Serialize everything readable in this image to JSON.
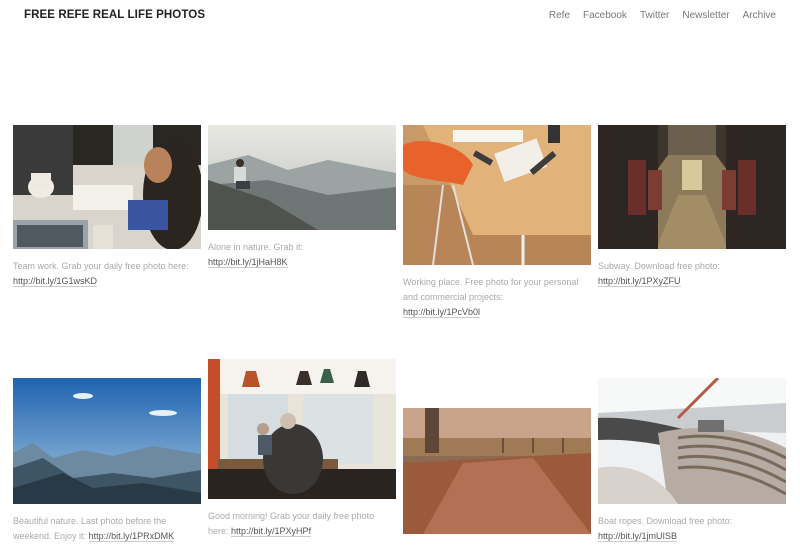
{
  "site": {
    "title": "FREE REFE REAL LIFE PHOTOS"
  },
  "nav": [
    {
      "label": "Refe"
    },
    {
      "label": "Facebook"
    },
    {
      "label": "Twitter"
    },
    {
      "label": "Newsletter"
    },
    {
      "label": "Archive"
    }
  ],
  "posts": [
    {
      "caption": "Team work. Grab your daily free photo here:",
      "link": "http://bit.ly/1G1wsKD"
    },
    {
      "caption": "Alone in nature. Grab it:",
      "link": "http://bit.ly/1jHaH8K"
    },
    {
      "caption": "Working place. Free photo for your personal and commercial projects:",
      "link": "http://bit.ly/1PcVb0l"
    },
    {
      "caption": "Subway. Download free photo:",
      "link": "http://bit.ly/1PXyZFU"
    },
    {
      "caption": "Beautiful nature. Last photo before the weekend. Enjoy it:",
      "link": "http://bit.ly/1PRxDMK"
    },
    {
      "caption": "Good morning! Grab your daily free photo here:",
      "link": "http://bit.ly/1PXyHPf"
    },
    {
      "caption": "",
      "link": ""
    },
    {
      "caption": "Boat ropes. Download free photo:",
      "link": "http://bit.ly/1jmUISB"
    }
  ]
}
